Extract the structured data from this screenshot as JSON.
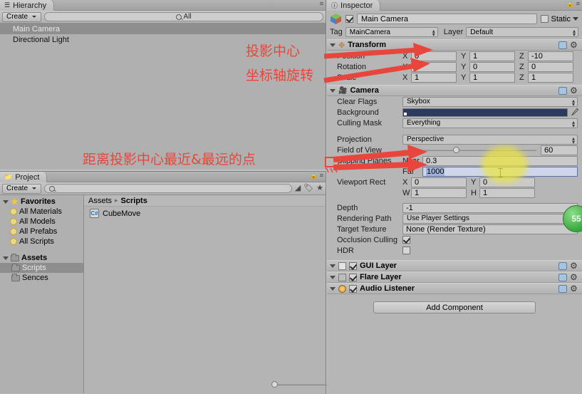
{
  "hierarchy": {
    "tab_label": "Hierarchy",
    "create_label": "Create",
    "search_placeholder": "All",
    "search_value": "All",
    "items": [
      {
        "label": "Main Camera",
        "selected": true
      },
      {
        "label": "Directional Light",
        "selected": false
      }
    ]
  },
  "project": {
    "tab_label": "Project",
    "create_label": "Create",
    "search_value": "",
    "favorites": {
      "label": "Favorites",
      "items": [
        "All Materials",
        "All Models",
        "All Prefabs",
        "All Scripts"
      ]
    },
    "assets_tree": {
      "label": "Assets",
      "items": [
        {
          "label": "Scripts",
          "selected": true
        },
        {
          "label": "Sences",
          "selected": false
        }
      ]
    },
    "breadcrumb": {
      "root": "Assets",
      "separator": "▸",
      "current": "Scripts"
    },
    "files": [
      {
        "label": "CubeMove",
        "icon": "csharp-script-icon"
      }
    ]
  },
  "inspector": {
    "tab_label": "Inspector",
    "object": {
      "name": "Main Camera",
      "enabled": true,
      "static_label": "Static",
      "tag_label": "Tag",
      "tag_value": "MainCamera",
      "layer_label": "Layer",
      "layer_value": "Default"
    },
    "transform": {
      "title": "Transform",
      "rows": [
        {
          "label": "Position",
          "x": "0",
          "y": "1",
          "z": "-10"
        },
        {
          "label": "Rotation",
          "x": "0",
          "y": "0",
          "z": "0"
        },
        {
          "label": "Scale",
          "x": "1",
          "y": "1",
          "z": "1"
        }
      ],
      "axis_x": "X",
      "axis_y": "Y",
      "axis_z": "Z"
    },
    "camera": {
      "title": "Camera",
      "clear_flags_label": "Clear Flags",
      "clear_flags_value": "Skybox",
      "background_label": "Background",
      "background_color": "#2b3a5e",
      "culling_mask_label": "Culling Mask",
      "culling_mask_value": "Everything",
      "projection_label": "Projection",
      "projection_value": "Perspective",
      "fov_label": "Field of View",
      "fov_value": "60",
      "clipping_label": "Clipping Planes",
      "near_label": "Near",
      "near_value": "0.3",
      "far_label": "Far",
      "far_value": "1000",
      "viewport_label": "Viewport Rect",
      "viewport_x_label": "X",
      "viewport_x": "0",
      "viewport_y_label": "Y",
      "viewport_y": "0",
      "viewport_w_label": "W",
      "viewport_w": "1",
      "viewport_h_label": "H",
      "viewport_h": "1",
      "depth_label": "Depth",
      "depth_value": "-1",
      "rendering_path_label": "Rendering Path",
      "rendering_path_value": "Use Player Settings",
      "target_texture_label": "Target Texture",
      "target_texture_value": "None (Render Texture)",
      "occlusion_label": "Occlusion Culling",
      "occlusion_checked": true,
      "hdr_label": "HDR",
      "hdr_checked": false
    },
    "components": [
      {
        "title": "GUI Layer",
        "enabled": true
      },
      {
        "title": "Flare Layer",
        "enabled": true
      },
      {
        "title": "Audio Listener",
        "enabled": true
      }
    ],
    "add_component_label": "Add Component"
  },
  "annotations": {
    "color": "#e8463c",
    "notes": [
      {
        "text": "投影中心"
      },
      {
        "text": "坐标轴旋转"
      },
      {
        "text": "距离投影中心最近&最远的点"
      }
    ]
  },
  "badge": {
    "value": "55",
    "color": "#35a83a"
  }
}
